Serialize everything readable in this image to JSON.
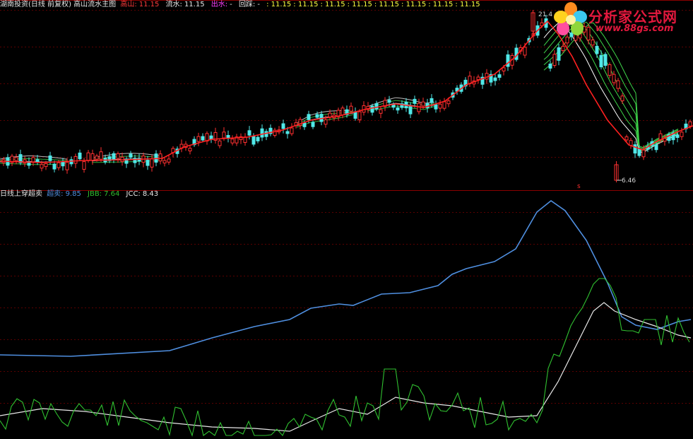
{
  "top_header": {
    "title": "湖南投资(日线 前复权) 高山流水主图",
    "items": [
      {
        "label": "高山:",
        "value": "11.15",
        "color": "#ff3b3b"
      },
      {
        "label": "流水:",
        "value": "11.15",
        "color": "#e8e8e8"
      },
      {
        "label": "出水:",
        "value": "",
        "color": "#ff40ff"
      },
      {
        "label": "回踩:",
        "value": "",
        "color": "#e8e8e8"
      }
    ],
    "extra_values": [
      "11.15",
      "11.15",
      "11.15",
      "11.15",
      "11.15",
      "11.15",
      "11.15",
      "11.15"
    ],
    "extra_color": "#ffff40"
  },
  "bottom_header": {
    "title": "日线上穿超卖",
    "items": [
      {
        "label": "超卖:",
        "value": "9.85",
        "color": "#4f8fe0"
      },
      {
        "label": "JBB:",
        "value": "7.64",
        "color": "#30c030"
      },
      {
        "label": "JCC:",
        "value": "8.43",
        "color": "#e8e8e8"
      }
    ]
  },
  "price_annotations": {
    "high_label": "21.4",
    "low_label": "6.46",
    "marker_label": "s"
  },
  "watermark": {
    "title": "分析家公式网",
    "url": "www.88gs.com"
  },
  "colors": {
    "background": "#000000",
    "up_candle": "#ff3030",
    "down_candle": "#50e8e8",
    "main_line": "#ff2020",
    "grid": "#5a0000",
    "oversold_line": "#4f8fe0",
    "jbb_line": "#30c030",
    "jcc_line": "#e8e8e8"
  },
  "chart_data": [
    {
      "type": "candlestick",
      "title": "湖南投资(日线 前复权) 高山流水主图",
      "low": 6.46,
      "high": 21.4,
      "series": [
        {
          "name": "高山",
          "last_value": 11.15
        },
        {
          "name": "流水",
          "last_value": 11.15
        }
      ]
    },
    {
      "type": "line",
      "title": "日线上穿超卖",
      "series": [
        {
          "name": "超卖",
          "last_value": 9.85
        },
        {
          "name": "JBB",
          "last_value": 7.64
        },
        {
          "name": "JCC",
          "last_value": 8.43
        }
      ]
    }
  ]
}
